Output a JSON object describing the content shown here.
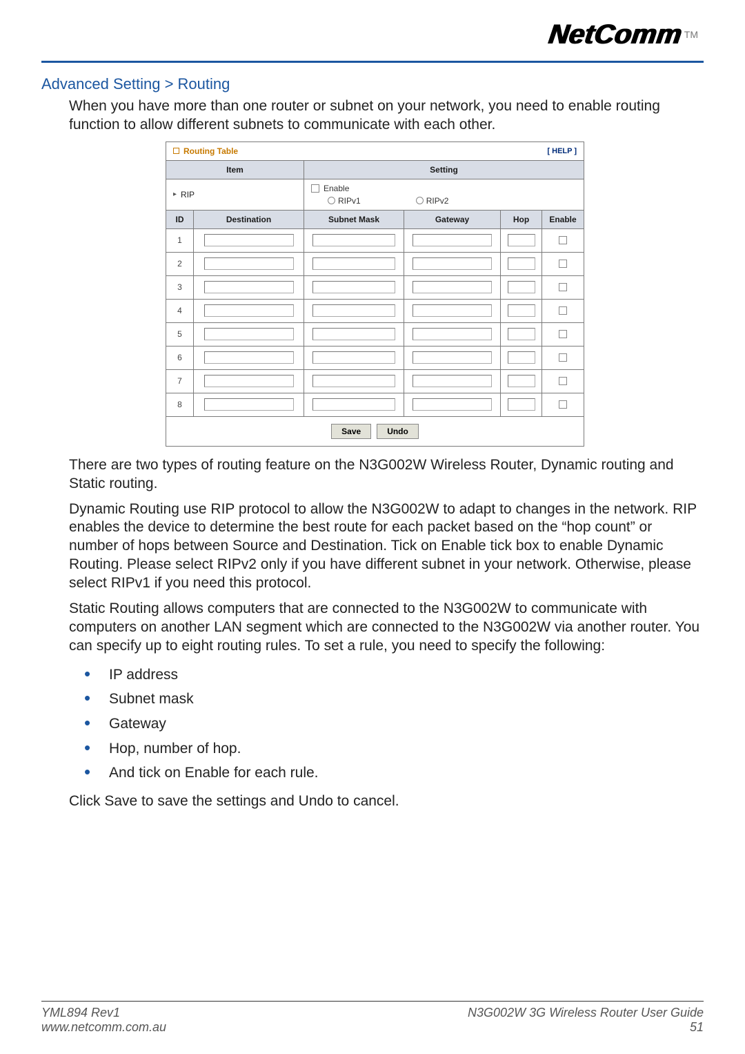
{
  "logo": {
    "brand": "NetComm",
    "tm": "TM"
  },
  "section_title": "Advanced Setting > Routing",
  "intro": "When you have more than one router or subnet on your network, you need to enable routing function to allow different subnets to communicate with each other.",
  "routing_shot": {
    "title": "Routing Table",
    "help": "[ HELP ]",
    "head_item": "Item",
    "head_setting": "Setting",
    "rip_label": "RIP",
    "enable_label": "Enable",
    "ripv1_label": "RIPv1",
    "ripv2_label": "RIPv2",
    "cols": {
      "id": "ID",
      "dest": "Destination",
      "mask": "Subnet Mask",
      "gw": "Gateway",
      "hop": "Hop",
      "en": "Enable"
    },
    "rows": [
      {
        "id": "1",
        "dest": "",
        "mask": "",
        "gw": "",
        "hop": "",
        "enable": false
      },
      {
        "id": "2",
        "dest": "",
        "mask": "",
        "gw": "",
        "hop": "",
        "enable": false
      },
      {
        "id": "3",
        "dest": "",
        "mask": "",
        "gw": "",
        "hop": "",
        "enable": false
      },
      {
        "id": "4",
        "dest": "",
        "mask": "",
        "gw": "",
        "hop": "",
        "enable": false
      },
      {
        "id": "5",
        "dest": "",
        "mask": "",
        "gw": "",
        "hop": "",
        "enable": false
      },
      {
        "id": "6",
        "dest": "",
        "mask": "",
        "gw": "",
        "hop": "",
        "enable": false
      },
      {
        "id": "7",
        "dest": "",
        "mask": "",
        "gw": "",
        "hop": "",
        "enable": false
      },
      {
        "id": "8",
        "dest": "",
        "mask": "",
        "gw": "",
        "hop": "",
        "enable": false
      }
    ],
    "save": "Save",
    "undo": "Undo"
  },
  "para2": "There are two types of routing feature on the N3G002W Wireless Router, Dynamic routing and Static routing.",
  "para3": "Dynamic Routing use RIP protocol to allow the N3G002W to adapt to changes in the network. RIP enables the device to determine the best route for each packet based on the “hop count” or number of hops between Source and Destination. Tick on Enable tick box to enable Dynamic Routing. Please select RIPv2 only if you have different subnet in your network. Otherwise, please select RIPv1 if you need this protocol.",
  "para4": "Static Routing allows computers that are connected to the N3G002W to communicate with computers on another LAN segment which are connected to the N3G002W via another router. You can specify up to eight routing rules. To set a rule, you need to specify the following:",
  "rules": [
    "IP address",
    "Subnet mask",
    "Gateway",
    "Hop, number of hop.",
    "And tick on Enable for each rule."
  ],
  "para5": "Click Save to save the settings and Undo to cancel.",
  "footer": {
    "rev": "YML894 Rev1",
    "url": "www.netcomm.com.au",
    "guide": "N3G002W 3G Wireless Router User Guide",
    "page": "51"
  }
}
